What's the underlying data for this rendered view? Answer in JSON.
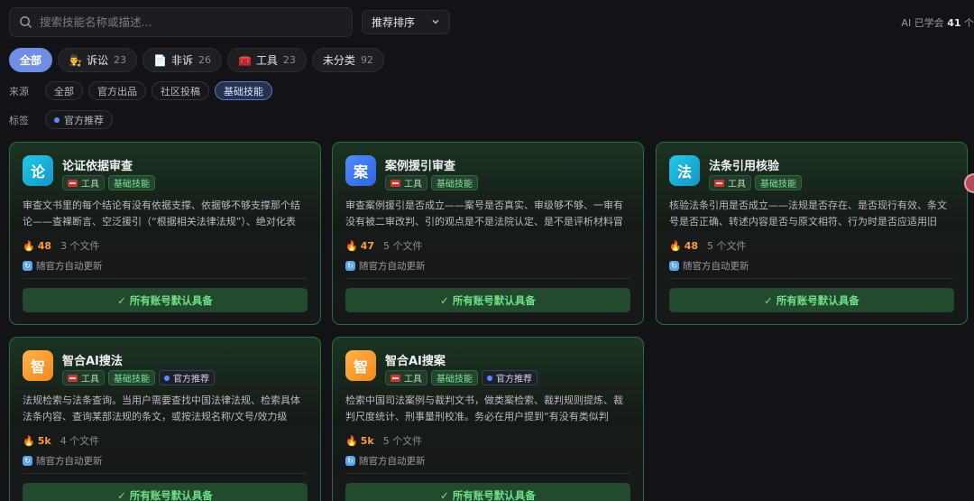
{
  "search": {
    "placeholder": "搜索技能名称或描述..."
  },
  "sort": {
    "label": "推荐排序"
  },
  "learned": {
    "prefix": "AI 已学会",
    "count": "41",
    "suffix": "个"
  },
  "categories": [
    {
      "label": "全部",
      "count": "",
      "icon": ""
    },
    {
      "label": "诉讼",
      "count": "23",
      "icon": "judge-icon"
    },
    {
      "label": "非诉",
      "count": "26",
      "icon": "document-icon"
    },
    {
      "label": "工具",
      "count": "23",
      "icon": "toolbox-icon"
    },
    {
      "label": "未分类",
      "count": "92",
      "icon": ""
    }
  ],
  "filters": {
    "source_label": "来源",
    "sources": [
      "全部",
      "官方出品",
      "社区投稿",
      "基础技能"
    ],
    "tag_label": "标签",
    "tags": [
      "官方推荐"
    ]
  },
  "cards": [
    {
      "avatar": "论",
      "title": "论证依据审查",
      "color": "cyan",
      "tags": [
        "工具",
        "基础技能"
      ],
      "desc": "审查文书里的每个结论有没有依据支撑、依据够不够支撑那个结论——查裸断言、空泛援引（“根据相关法律法规”）、绝对化表述…",
      "heat": "48",
      "files": "3 个文件",
      "auto": "随官方自动更新",
      "default": "所有账号默认具备"
    },
    {
      "avatar": "案",
      "title": "案例援引审查",
      "color": "blue",
      "tags": [
        "工具",
        "基础技能"
      ],
      "desc": "审查案例援引是否成立——案号是否真实、审级够不够、一审有没有被二审改判、引的观点是不是法院认定、是不是评析材料冒充…",
      "heat": "47",
      "files": "5 个文件",
      "auto": "随官方自动更新",
      "default": "所有账号默认具备"
    },
    {
      "avatar": "法",
      "title": "法条引用核验",
      "color": "cyan",
      "tags": [
        "工具",
        "基础技能"
      ],
      "desc": "核验法条引用是否成立——法规是否存在、是否现行有效、条文号是否正确、转述内容是否与原文相符、行为时是否应适用旧版。…",
      "heat": "48",
      "files": "5 个文件",
      "auto": "随官方自动更新",
      "default": "所有账号默认具备"
    },
    {
      "avatar": "智",
      "title": "智合AI搜法",
      "color": "orange",
      "tags": [
        "工具",
        "基础技能",
        "官方推荐"
      ],
      "desc": "法规检索与法条查询。当用户需要查找中国法律法规、检索具体法条内容、查询某部法规的条文，或按法规名称/文号/效力级别/…",
      "heat": "5k",
      "files": "4 个文件",
      "auto": "随官方自动更新",
      "default": "所有账号默认具备"
    },
    {
      "avatar": "智",
      "title": "智合AI搜案",
      "color": "orange",
      "tags": [
        "工具",
        "基础技能",
        "官方推荐"
      ],
      "desc": "检索中国司法案例与裁判文书，做类案检索、裁判规则提炼、裁判尺度统计、刑事量刑校准。务必在用户提到“有没有类似判决”“法…",
      "heat": "5k",
      "files": "5 个文件",
      "auto": "随官方自动更新",
      "default": "所有账号默认具备"
    }
  ],
  "colors": {
    "accent": "#6f8fe6",
    "card_border": "#2c6d3a",
    "heat": "#ff9a3c",
    "success": "#6fe08a"
  }
}
